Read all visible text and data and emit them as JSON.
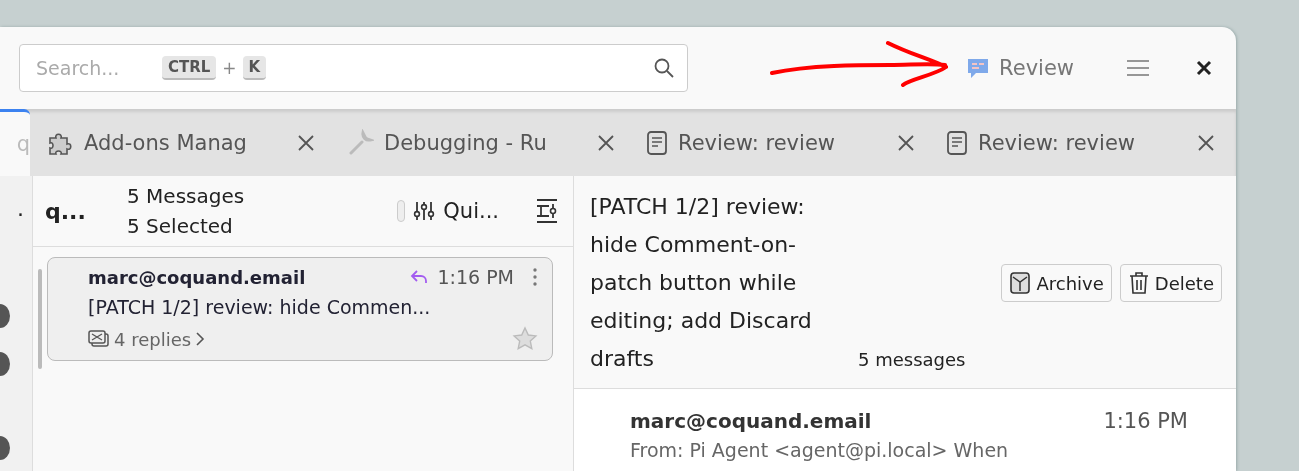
{
  "header": {
    "search": {
      "placeholder": "Search...",
      "keys": [
        "CTRL",
        "K"
      ],
      "joiner": "+"
    },
    "review_button": {
      "label": "Review"
    },
    "annotation": {
      "kind": "arrow"
    }
  },
  "tabs": [
    {
      "label": "q",
      "kind": "blank",
      "selected": true
    },
    {
      "label": "Add-ons Manag",
      "kind": "puzzle",
      "selected": false
    },
    {
      "label": "Debugging - Ru",
      "kind": "wrench",
      "selected": false
    },
    {
      "label": "Review: review",
      "kind": "document",
      "selected": false
    },
    {
      "label": "Review: review",
      "kind": "document",
      "selected": false
    }
  ],
  "folder_pane": {
    "label": "."
  },
  "thread_pane": {
    "folder": "q...",
    "count": "5 Messages",
    "selected_count": "5 Selected",
    "quick_filter": "Qui...",
    "toggle": {
      "on": false
    },
    "messages": [
      {
        "sender": "marc@coquand.email",
        "time": "1:16 PM",
        "subject": "[PATCH 1/2] review: hide Commen...",
        "replies": "4 replies",
        "replied": true,
        "starred": false,
        "selected": true
      }
    ]
  },
  "message_view": {
    "subject": "[PATCH 1/2] review: hide Comment-on-patch button while editing; add Discard drafts",
    "count": "5 messages",
    "buttons": [
      {
        "label": "Archive",
        "kind": "archive"
      },
      {
        "label": "Delete",
        "kind": "delete"
      }
    ],
    "message": {
      "sender": "marc@coquand.email",
      "time": "1:16 PM",
      "preview": "From: Pi Agent <agent@pi.local> When"
    }
  }
}
